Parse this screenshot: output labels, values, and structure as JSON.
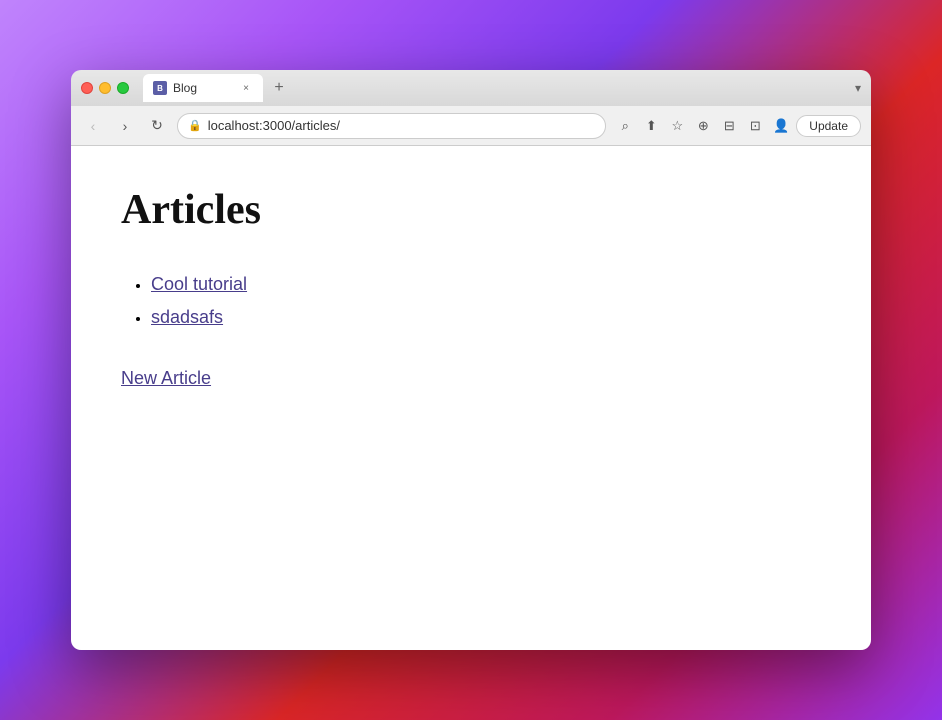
{
  "browser": {
    "tab": {
      "favicon_text": "B",
      "title": "Blog",
      "close_symbol": "×"
    },
    "new_tab_symbol": "+",
    "dropdown_symbol": "▾",
    "nav": {
      "back_symbol": "‹",
      "forward_symbol": "›",
      "refresh_symbol": "↻",
      "url": "localhost:3000/articles/",
      "lock_symbol": "🔒",
      "search_icon": "⌕",
      "share_icon": "⬆",
      "bookmark_icon": "☆",
      "extensions_icon": "⊕",
      "sidebar_icon": "⊟",
      "split_icon": "⊡",
      "profile_icon": "👤",
      "update_label": "Update"
    }
  },
  "page": {
    "title": "Articles",
    "articles": [
      {
        "label": "Cool tutorial",
        "href": "#"
      },
      {
        "label": "sdadsafs",
        "href": "#"
      }
    ],
    "new_article_label": "New Article"
  }
}
